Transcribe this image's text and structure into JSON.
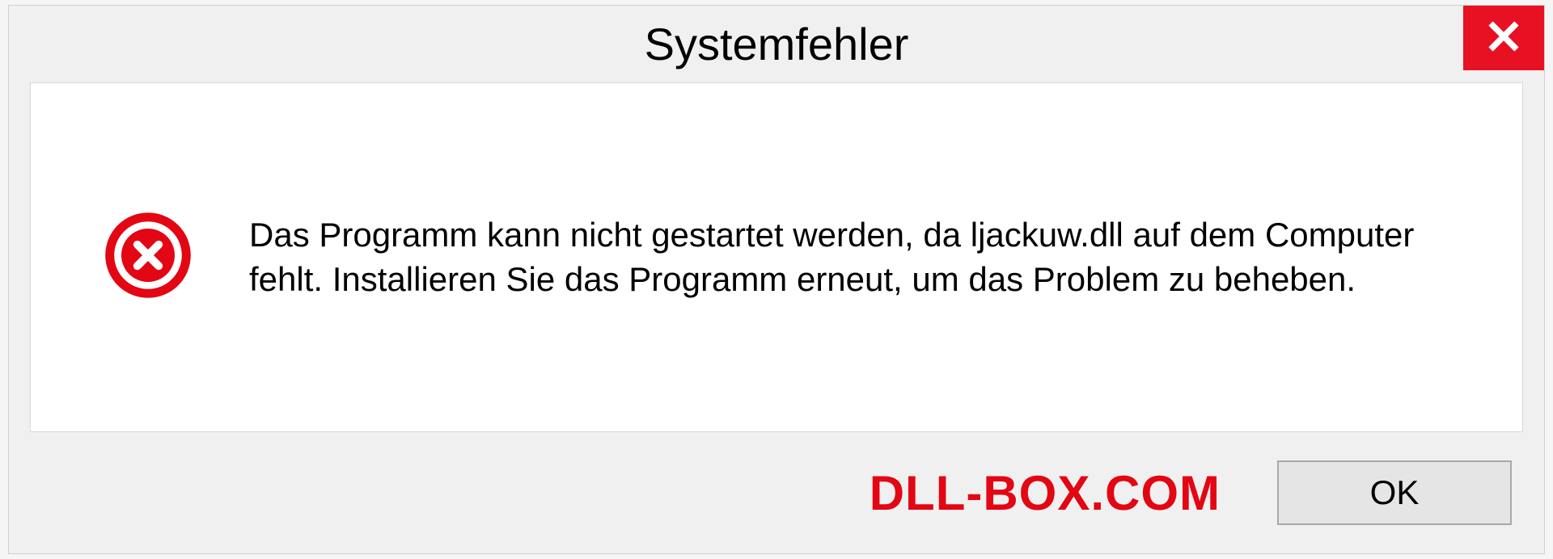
{
  "dialog": {
    "title": "Systemfehler",
    "message": "Das Programm kann nicht gestartet werden, da ljackuw.dll auf dem Computer fehlt. Installieren Sie das Programm erneut, um das Problem zu beheben.",
    "ok_label": "OK",
    "watermark": "DLL-BOX.COM",
    "colors": {
      "close_bg": "#e81123",
      "error_icon": "#e30613",
      "watermark": "#e30613"
    }
  }
}
